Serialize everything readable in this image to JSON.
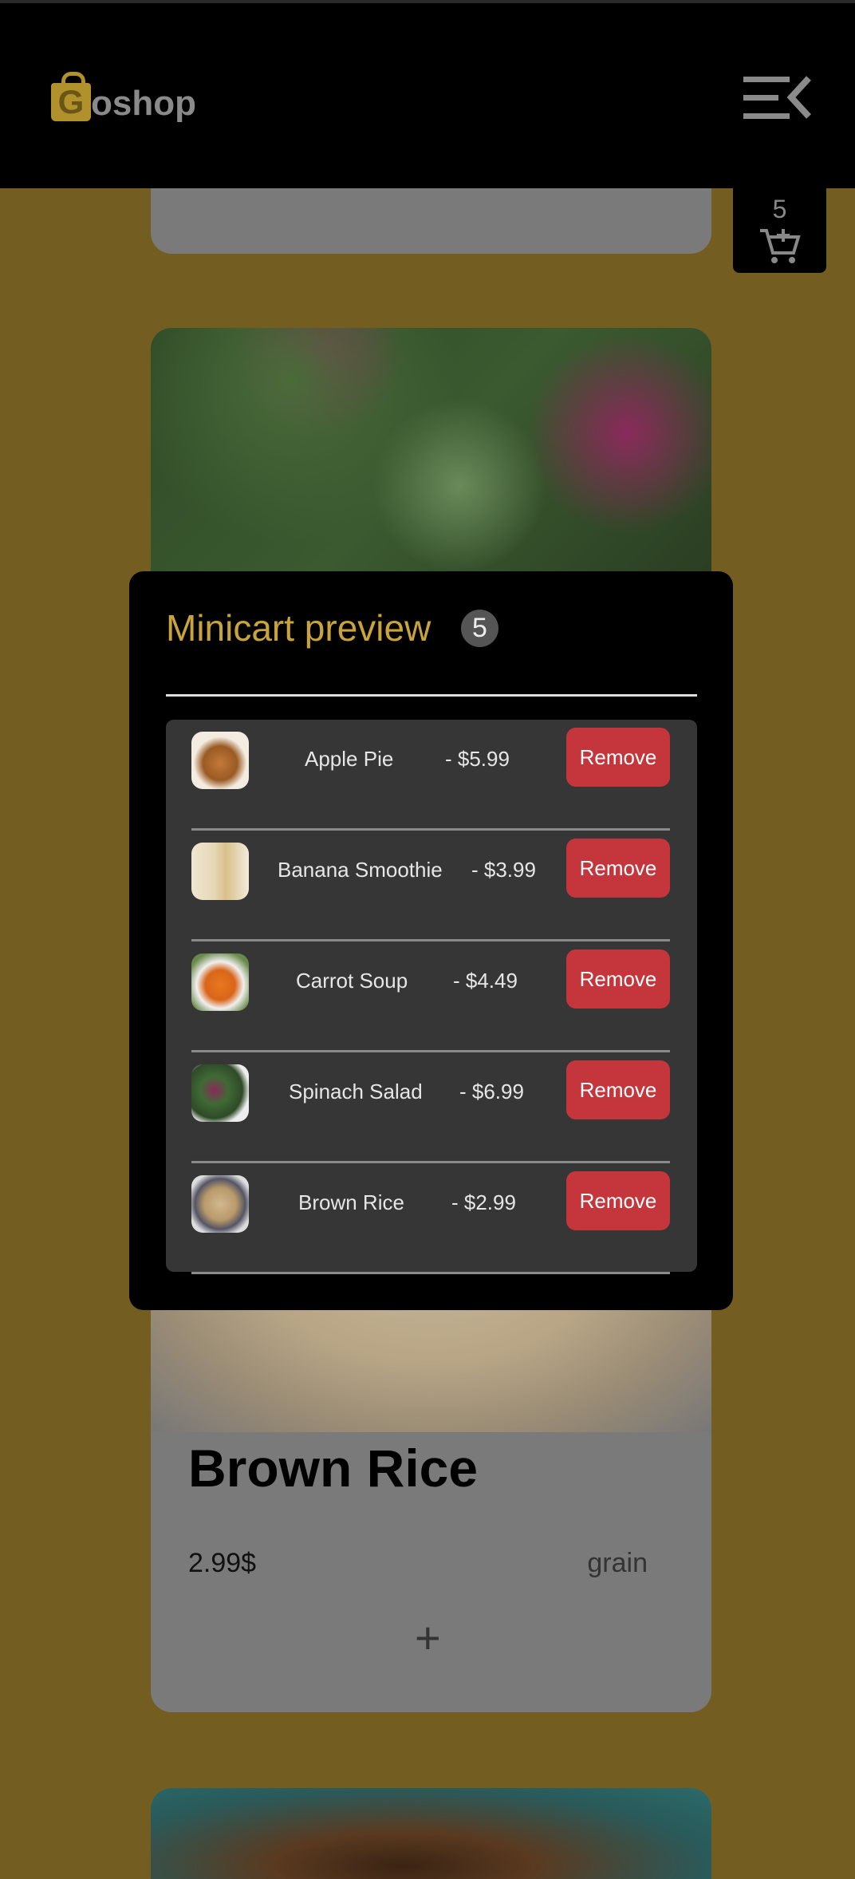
{
  "header": {
    "logo_letter": "G",
    "logo_text": "oshop",
    "menu_icon": "menu-collapse-icon"
  },
  "cart": {
    "count": "5",
    "icon": "cart-add-icon"
  },
  "product": {
    "title": "Brown Rice",
    "price": "2.99$",
    "category": "grain",
    "add_label": "+"
  },
  "minicart": {
    "title": "Minicart preview",
    "count": "5",
    "remove_label": "Remove",
    "items": [
      {
        "name": "Apple Pie",
        "price": "- $5.99",
        "thumb_color": "#b36a2a"
      },
      {
        "name": "Banana Smoothie",
        "price": "- $3.99",
        "thumb_color": "#e8d9b8"
      },
      {
        "name": "Carrot Soup",
        "price": "- $4.49",
        "thumb_color": "#e07a1f"
      },
      {
        "name": "Spinach Salad",
        "price": "- $6.99",
        "thumb_color": "#3f6a35"
      },
      {
        "name": "Brown Rice",
        "price": "- $2.99",
        "thumb_color": "#c4a97e"
      }
    ]
  },
  "colors": {
    "accent": "#c8a43a",
    "remove": "#c5363c",
    "background": "#735d21"
  }
}
